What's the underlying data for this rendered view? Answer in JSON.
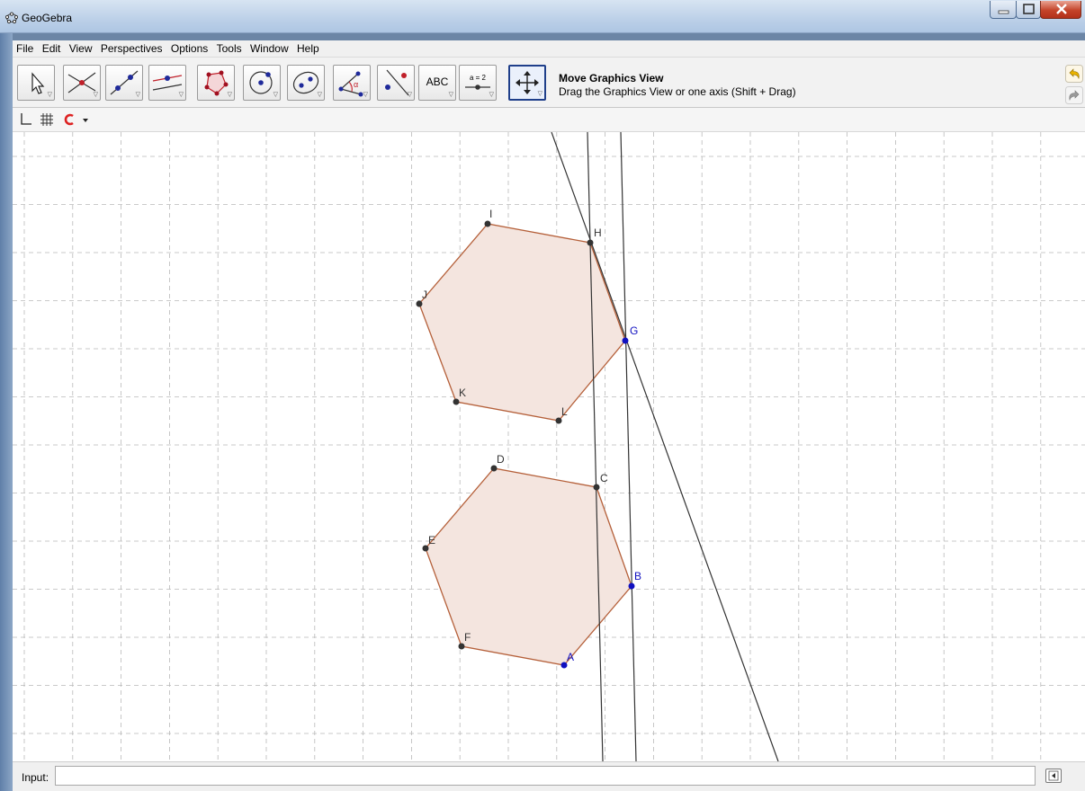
{
  "window": {
    "title": "GeoGebra"
  },
  "menu": [
    "File",
    "Edit",
    "View",
    "Perspectives",
    "Options",
    "Tools",
    "Window",
    "Help"
  ],
  "toolbar": {
    "tools": [
      {
        "name": "move-tool",
        "icon": "arrow-cursor-icon"
      },
      {
        "name": "point-tool",
        "icon": "intersect-point-icon"
      },
      {
        "name": "line-tool",
        "icon": "line-through-two-points-icon"
      },
      {
        "name": "perpendicular-line-tool",
        "icon": "parallel-lines-icon"
      },
      {
        "name": "polygon-tool",
        "icon": "polygon-icon"
      },
      {
        "name": "circle-tool",
        "icon": "circle-with-center-icon"
      },
      {
        "name": "conic-tool",
        "icon": "ellipse-icon"
      },
      {
        "name": "angle-tool",
        "icon": "angle-icon",
        "label": "α"
      },
      {
        "name": "reflect-tool",
        "icon": "reflect-about-line-icon"
      },
      {
        "name": "text-tool",
        "icon": "text-icon",
        "label": "ABC"
      },
      {
        "name": "slider-tool",
        "icon": "slider-icon",
        "label": "a = 2"
      },
      {
        "name": "move-graphics-view-tool",
        "icon": "move-graphics-view-icon",
        "active": true
      }
    ],
    "active_tool_title": "Move Graphics View",
    "active_tool_help": "Drag the Graphics View or one axis (Shift + Drag)"
  },
  "graphics": {
    "points": [
      {
        "label": "A",
        "color": "#1010c0"
      },
      {
        "label": "B",
        "color": "#1010c0"
      },
      {
        "label": "C",
        "color": "#333333"
      },
      {
        "label": "D",
        "color": "#333333"
      },
      {
        "label": "E",
        "color": "#333333"
      },
      {
        "label": "F",
        "color": "#333333"
      },
      {
        "label": "G",
        "color": "#1010c0"
      },
      {
        "label": "H",
        "color": "#333333"
      },
      {
        "label": "I",
        "color": "#333333"
      },
      {
        "label": "J",
        "color": "#333333"
      },
      {
        "label": "K",
        "color": "#333333"
      },
      {
        "label": "L",
        "color": "#333333"
      }
    ],
    "polygon_fill": "#f4e5df",
    "polygon_stroke": "#b5603a",
    "line_color": "#333333",
    "grid_color": "#b9b9b9"
  },
  "input": {
    "label": "Input:",
    "value": ""
  }
}
